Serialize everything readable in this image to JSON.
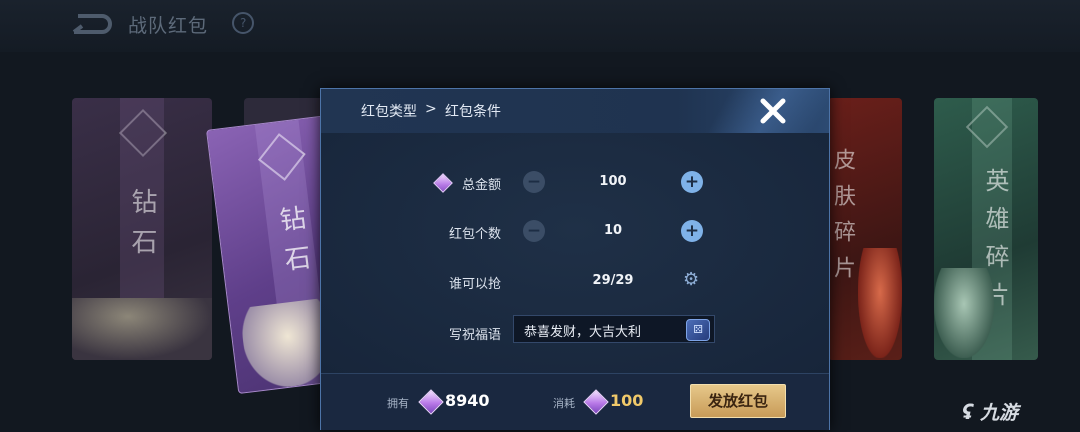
{
  "page_title": "战队红包",
  "icons": {
    "back": "back-arrow-icon",
    "help": "question-icon",
    "close": "close-icon",
    "diamond": "diamond-gem-icon",
    "minus": "minus-icon",
    "plus": "plus-icon",
    "settings": "gear-icon",
    "dice": "dice-icon"
  },
  "cards": [
    {
      "chars": "钻石",
      "theme": "purple"
    },
    {
      "chars": "钻石",
      "theme": "purple-selected"
    },
    {
      "chars": "皮肤碎片",
      "theme": "red"
    },
    {
      "chars": "英雄碎片",
      "theme": "green"
    }
  ],
  "dialog": {
    "breadcrumb": {
      "first": "红包类型",
      "separator": ">",
      "current": "红包条件"
    },
    "rows": {
      "total_amount": {
        "label": "总金额",
        "value": "100"
      },
      "count": {
        "label": "红包个数",
        "value": "10"
      },
      "who_can_grab": {
        "label": "谁可以抢",
        "value": "29/29"
      },
      "greeting": {
        "label": "写祝福语",
        "value": "恭喜发财，大吉大利"
      }
    },
    "footer": {
      "own_label": "拥有",
      "own_value": "8940",
      "cost_label": "消耗",
      "cost_value": "100",
      "send_button": "发放红包"
    }
  },
  "watermark": "九游",
  "colors": {
    "dialog_bg": "#1d2d44",
    "dialog_border": "#4d74a8",
    "accent_blue": "#7fb2e8",
    "gold": "#f0c96a",
    "button_gold": "#d9b474"
  }
}
